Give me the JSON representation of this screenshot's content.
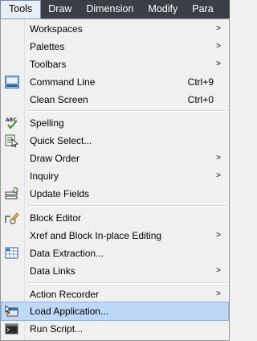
{
  "menubar": {
    "items": [
      "Tools",
      "Draw",
      "Dimension",
      "Modify",
      "Para"
    ]
  },
  "menu": {
    "items": [
      {
        "label": "Workspaces",
        "submenu": true
      },
      {
        "label": "Palettes",
        "submenu": true
      },
      {
        "label": "Toolbars",
        "submenu": true
      },
      {
        "label": "Command Line",
        "shortcut": "Ctrl+9",
        "icon": "command-line-icon"
      },
      {
        "label": "Clean Screen",
        "shortcut": "Ctrl+0"
      },
      {
        "label": "Spelling",
        "icon": "spelling-icon"
      },
      {
        "label": "Quick Select...",
        "icon": "quick-select-icon"
      },
      {
        "label": "Draw Order",
        "submenu": true
      },
      {
        "label": "Inquiry",
        "submenu": true
      },
      {
        "label": "Update Fields",
        "icon": "update-fields-icon"
      },
      {
        "label": "Block Editor",
        "icon": "block-editor-icon"
      },
      {
        "label": "Xref and Block In-place Editing",
        "submenu": true
      },
      {
        "label": "Data Extraction...",
        "icon": "data-extraction-icon"
      },
      {
        "label": "Data Links",
        "submenu": true
      },
      {
        "label": "Action Recorder",
        "submenu": true
      },
      {
        "label": "Load Application...",
        "icon": "load-application-icon",
        "highlighted": true
      },
      {
        "label": "Run Script...",
        "icon": "run-script-icon"
      }
    ],
    "submenu_arrow": ">",
    "spelling_icon_text": "ABC"
  },
  "colors": {
    "menubar_bg": "#3b3f45",
    "highlight": "#bdd9f5"
  }
}
